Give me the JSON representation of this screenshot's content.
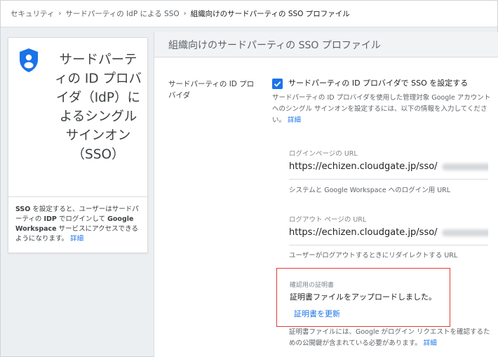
{
  "breadcrumb": {
    "item1": "セキュリティ",
    "item2": "サードパーティの IdP による SSO",
    "current": "組織向けのサードパーティの SSO プロファイル",
    "separator": "›"
  },
  "left_card": {
    "title": "サードパーティの ID プロバイダ（IdP）によるシングル サインオン（SSO）",
    "desc_prefix": "",
    "desc_sso": "SSO",
    "desc_part1": " を設定すると、ユーザーはサードパーティの ",
    "desc_idp": "IDP",
    "desc_part2": " でログインして ",
    "desc_gw": "Google Workspace",
    "desc_part3": " サービスにアクセスできるようになります。",
    "desc_link": "詳細",
    "icon": "shield-person-icon"
  },
  "main": {
    "header": "組織向けのサードパーティの SSO プロファイル",
    "setting_label": "サードパーティの ID プロバイダ",
    "checkbox_label": "サードパーティの ID プロバイダで SSO を設定する",
    "checkbox_checked": true,
    "checkbox_desc": "サードパーティの ID プロバイダを使用した管理対象 Google アカウントへのシングル サインオンを設定するには、以下の情報を入力してください。",
    "checkbox_desc_link": "詳細",
    "login_url": {
      "label": "ログインページの URL",
      "value": "https://echizen.cloudgate.jp/sso/",
      "help": "システムと Google Workspace へのログイン用 URL"
    },
    "logout_url": {
      "label": "ログアウト ページの URL",
      "value": "https://echizen.cloudgate.jp/sso/",
      "help": "ユーザーがログアウトするときにリダイレクトする URL"
    },
    "certificate": {
      "label": "確認用の証明書",
      "status": "証明書ファイルをアップロードしました。",
      "update_link": "証明書を更新",
      "help": "証明書ファイルには、Google がログイン リクエストを確認するための公開鍵が含まれている必要があります。",
      "help_link": "詳細"
    }
  },
  "colors": {
    "accent": "#1a73e8",
    "highlight_border": "#e53935",
    "header_bg": "#f1f3f4"
  }
}
